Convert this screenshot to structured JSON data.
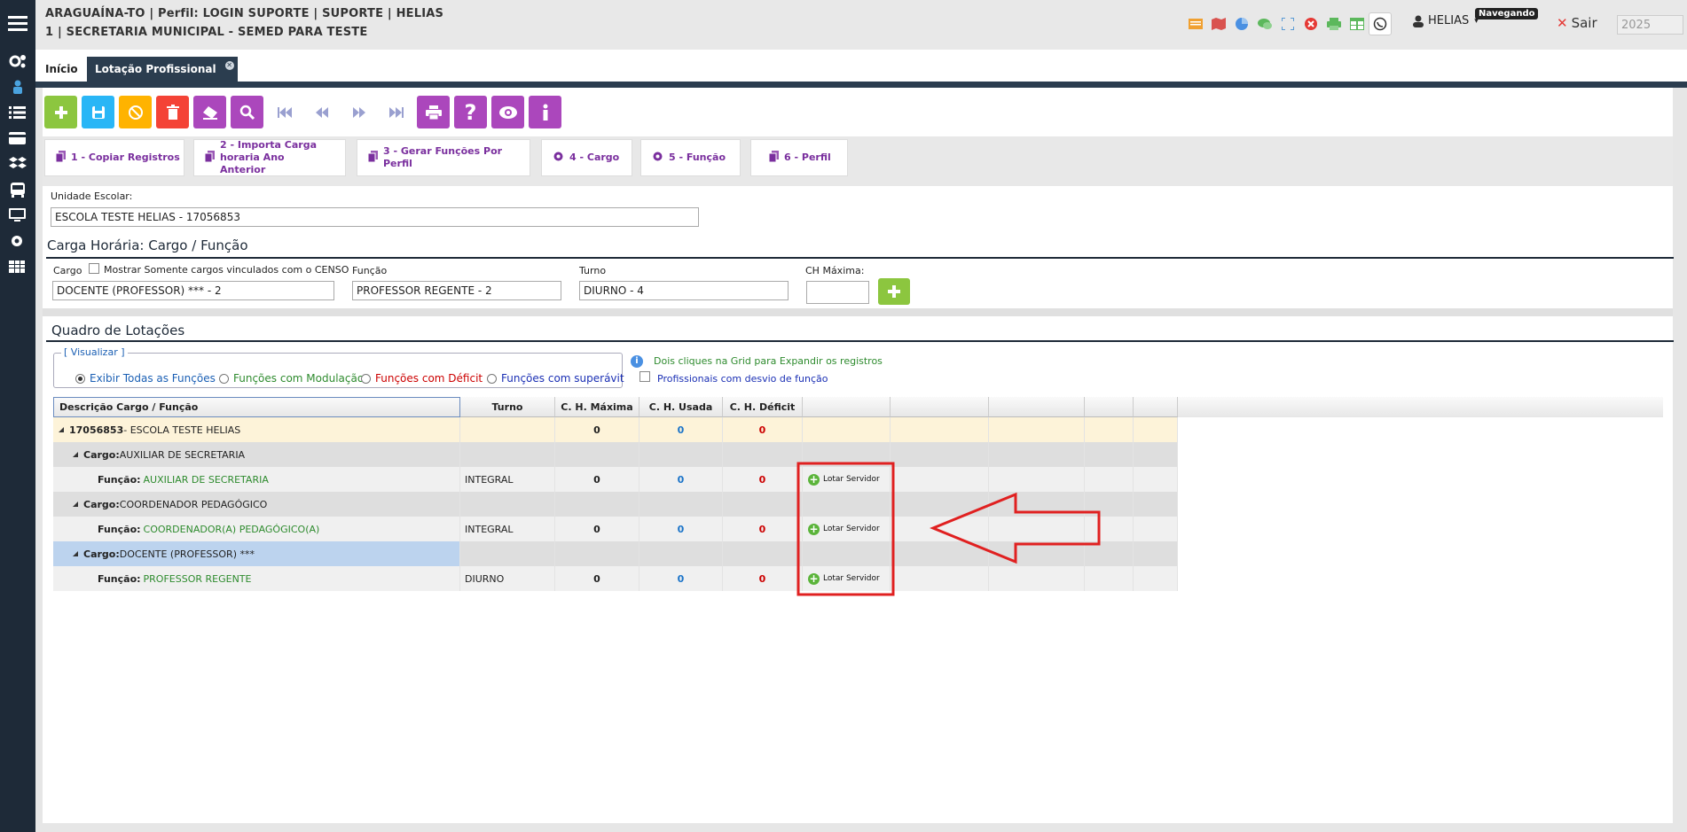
{
  "header": {
    "line1": "ARAGUAÍNA-TO | Perfil: LOGIN SUPORTE | SUPORTE | HELIAS",
    "line2": "1 | SECRETARIA MUNICIPAL - SEMED PARA TESTE",
    "user": "HELIAS",
    "badge": "Navegando",
    "sair": "Sair",
    "year": "2025",
    "icons": [
      "list-icon",
      "map-icon",
      "pie-chart-icon",
      "chat-icon",
      "fullscreen-icon",
      "close-circle-icon",
      "print-icon",
      "table-icon",
      "whatsapp-icon"
    ]
  },
  "sidebar": {
    "icons": [
      "menu-icon",
      "cogs-icon",
      "user-icon",
      "list-icon",
      "card-icon",
      "dropbox-icon",
      "bus-icon",
      "monitor-icon",
      "gear-icon",
      "table-icon"
    ]
  },
  "tabs": [
    {
      "label": "Início"
    },
    {
      "label": "Lotação Profissional"
    }
  ],
  "toolbar": {
    "buttons": [
      {
        "name": "add",
        "color": "#8cc63f"
      },
      {
        "name": "save",
        "color": "#29b6f6"
      },
      {
        "name": "cancel",
        "color": "#ffb300"
      },
      {
        "name": "delete",
        "color": "#f44336"
      },
      {
        "name": "erase",
        "color": "#ab47bc"
      },
      {
        "name": "search",
        "color": "#ab47bc"
      },
      {
        "name": "first",
        "color": "none"
      },
      {
        "name": "prev",
        "color": "none"
      },
      {
        "name": "next",
        "color": "none"
      },
      {
        "name": "last",
        "color": "none"
      },
      {
        "name": "print",
        "color": "#ab47bc"
      },
      {
        "name": "help",
        "color": "#ab47bc"
      },
      {
        "name": "view",
        "color": "#ab47bc"
      },
      {
        "name": "info",
        "color": "#ab47bc"
      }
    ]
  },
  "shortcuts": [
    {
      "label": "1 - Copiar Registros",
      "icon": "copy-icon"
    },
    {
      "label": "2 - Importa Carga horaria Ano Anterior",
      "icon": "copy-icon"
    },
    {
      "label": "3 - Gerar Funções Por Perfil",
      "icon": "copy-icon"
    },
    {
      "label": "4 - Cargo",
      "icon": "gear-icon"
    },
    {
      "label": "5 - Função",
      "icon": "gear-icon"
    },
    {
      "label": "6 - Perfil",
      "icon": "copy-icon"
    }
  ],
  "unidade": {
    "label": "Unidade Escolar:",
    "value": "ESCOLA TESTE HELIAS - 17056853"
  },
  "carga": {
    "title": "Carga Horária: Cargo / Função",
    "cargo_label": "Cargo",
    "censo_label": "Mostrar Somente cargos vinculados com o CENSO",
    "cargo_value": "DOCENTE (PROFESSOR) *** - 2",
    "funcao_label": "Função",
    "funcao_value": "PROFESSOR REGENTE - 2",
    "turno_label": "Turno",
    "turno_value": "DIURNO - 4",
    "ch_label": "CH Máxima:",
    "ch_value": ""
  },
  "quadro": {
    "title": "Quadro de Lotações",
    "visualizar": "[ Visualizar ]",
    "radios": [
      {
        "label": "Exibir Todas as Funções",
        "color": "#1a5fb4",
        "checked": true
      },
      {
        "label": "Funções com Modulação",
        "color": "#2e8b2e",
        "checked": false
      },
      {
        "label": "Funções com Déficit",
        "color": "#cc0000",
        "checked": false
      },
      {
        "label": "Funções com superávit",
        "color": "#1a2fb4",
        "checked": false
      }
    ],
    "hint": "Dois cliques na Grid para Expandir os registros",
    "desvio_label": "Profissionais com desvio de função"
  },
  "grid": {
    "headers": [
      "Descrição Cargo / Função",
      "Turno",
      "C. H. Máxima",
      "C. H. Usada",
      "C. H. Déficit"
    ],
    "lotar_label": "Lotar Servidor",
    "rows": [
      {
        "type": "escola",
        "code": "17056853",
        "text": " - ESCOLA TESTE HELIAS",
        "turno": "",
        "max": "0",
        "usada": "0",
        "deficit": "0"
      },
      {
        "type": "cargo",
        "prefix": "Cargo:",
        "text": "AUXILIAR DE SECRETARIA"
      },
      {
        "type": "funcao",
        "prefix": "Função:",
        "text": "AUXILIAR DE SECRETARIA",
        "turno": "INTEGRAL",
        "max": "0",
        "usada": "0",
        "deficit": "0"
      },
      {
        "type": "cargo",
        "prefix": "Cargo:",
        "text": "COORDENADOR PEDAGÓGICO"
      },
      {
        "type": "funcao",
        "prefix": "Função:",
        "text": "COORDENADOR(A) PEDAGÓGICO(A)",
        "turno": "INTEGRAL",
        "max": "0",
        "usada": "0",
        "deficit": "0"
      },
      {
        "type": "cargo",
        "prefix": "Cargo:",
        "text": "DOCENTE (PROFESSOR) ***",
        "selected": true
      },
      {
        "type": "funcao",
        "prefix": "Função:",
        "text": "PROFESSOR REGENTE",
        "turno": "DIURNO",
        "max": "0",
        "usada": "0",
        "deficit": "0"
      }
    ]
  },
  "annotation": {
    "color": "#e02020"
  }
}
